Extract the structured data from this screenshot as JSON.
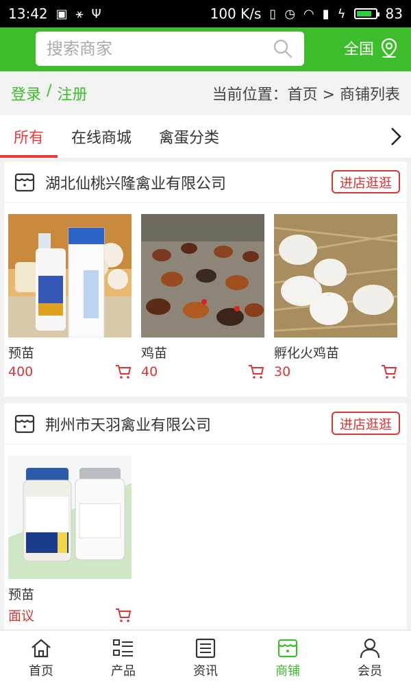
{
  "status_bar": {
    "time": "13:42",
    "network_speed": "100 K/s",
    "battery": "83",
    "battery_level": 0.83
  },
  "header": {
    "search_placeholder": "搜索商家",
    "region_label": "全国"
  },
  "subheader": {
    "login": "登录",
    "separator": "/",
    "register": "注册",
    "location": "当前位置：首页 > 商铺列表"
  },
  "tabs": [
    {
      "label": "所有",
      "active": true
    },
    {
      "label": "在线商城",
      "active": false
    },
    {
      "label": "禽蛋分类",
      "active": false
    }
  ],
  "shops": [
    {
      "name": "湖北仙桃兴隆禽业有限公司",
      "visit_label": "进店逛逛",
      "products": [
        {
          "name": "预苗",
          "price": "400",
          "image": "vaccine-spray"
        },
        {
          "name": "鸡苗",
          "price": "40",
          "image": "chickens"
        },
        {
          "name": "孵化火鸡苗",
          "price": "30",
          "image": "eggs"
        }
      ]
    },
    {
      "name": "荆州市天羽禽业有限公司",
      "visit_label": "进店逛逛",
      "products": [
        {
          "name": "预苗",
          "price": "面议",
          "image": "vaccine-vials"
        }
      ]
    }
  ],
  "bottom_nav": [
    {
      "label": "首页",
      "icon": "home-icon",
      "active": false
    },
    {
      "label": "产品",
      "icon": "list-icon",
      "active": false
    },
    {
      "label": "资讯",
      "icon": "news-icon",
      "active": false
    },
    {
      "label": "商铺",
      "icon": "store-icon",
      "active": true
    },
    {
      "label": "会员",
      "icon": "user-icon",
      "active": false
    }
  ],
  "colors": {
    "brand_green": "#3dbd2b",
    "accent_red": "#e53c3c"
  }
}
